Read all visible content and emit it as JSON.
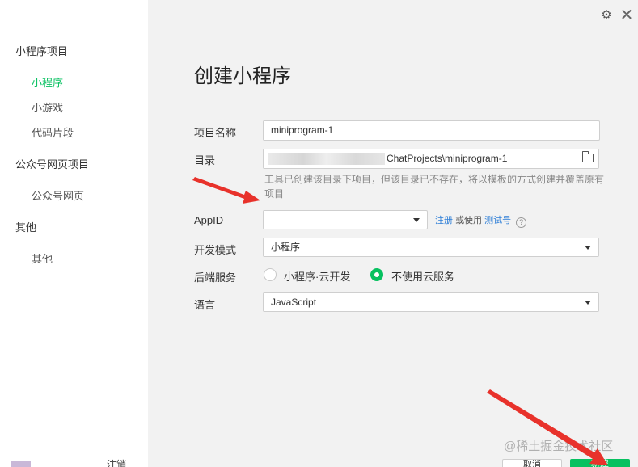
{
  "sidebar": {
    "sections": [
      {
        "label": "小程序项目",
        "items": [
          {
            "label": "小程序"
          },
          {
            "label": "小游戏"
          },
          {
            "label": "代码片段"
          }
        ]
      },
      {
        "label": "公众号网页项目",
        "items": [
          {
            "label": "公众号网页"
          }
        ]
      },
      {
        "label": "其他",
        "items": [
          {
            "label": "其他"
          }
        ]
      }
    ],
    "active_item": "小程序",
    "footer": {
      "user_label": "注销"
    }
  },
  "window": {
    "settings_icon": "gear-icon",
    "close_icon": "close-icon",
    "close_glyph": "✕",
    "settings_glyph": "⚙"
  },
  "form": {
    "title": "创建小程序",
    "project_name": {
      "label": "项目名称",
      "value": "miniprogram-1"
    },
    "directory": {
      "label": "目录",
      "value_visible": "ChatProjects\\miniprogram-1",
      "hint": "工具已创建该目录下项目，但该目录已不存在，将以模板的方式创建并覆盖原有项目"
    },
    "appid": {
      "label": "AppID",
      "value": "",
      "register_link": "注册",
      "or_use": "或使用",
      "test_link": "测试号",
      "help_glyph": "?"
    },
    "dev_mode": {
      "label": "开发模式",
      "value": "小程序"
    },
    "backend": {
      "label": "后端服务",
      "options": [
        {
          "label": "小程序·云开发",
          "selected": false
        },
        {
          "label": "不使用云服务",
          "selected": true
        }
      ]
    },
    "language": {
      "label": "语言",
      "value": "JavaScript"
    }
  },
  "footer_buttons": {
    "cancel_label": "取消",
    "create_label": "新建"
  },
  "watermark": "@稀土掘金技术社区",
  "colors": {
    "accent": "#07c160",
    "link": "#2f7fd7",
    "arrow": "#e8322b",
    "panel_bg": "#f2f2f2"
  }
}
